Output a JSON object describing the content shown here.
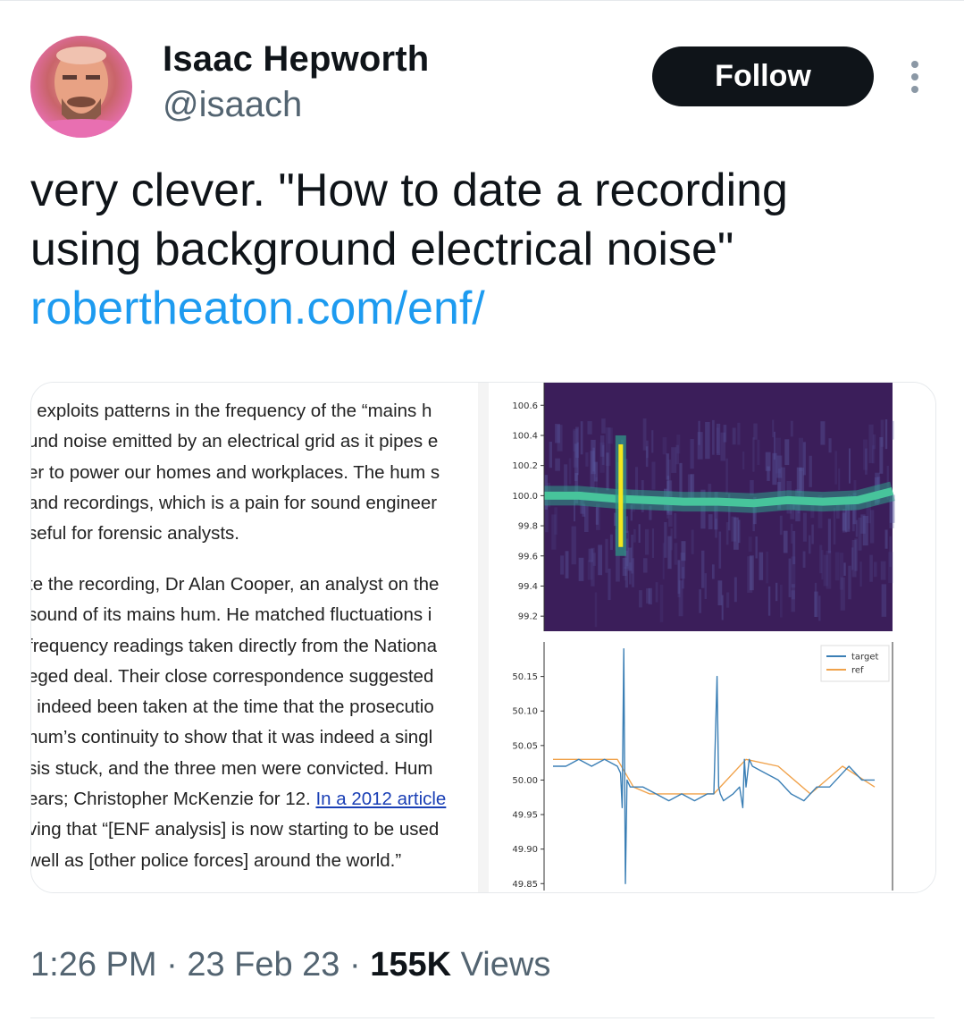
{
  "author": {
    "name": "Isaac Hepworth",
    "handle": "@isaach"
  },
  "follow_label": "Follow",
  "tweet": {
    "text_line1": "very clever. \"How to date a recording",
    "text_line2": "using background electrical noise\"",
    "link": "robertheaton.com/enf/"
  },
  "article": {
    "para1": [
      "j exploits patterns in the frequency of the “mains h",
      "und noise emitted by an electrical grid as it pipes e",
      "er to power our homes and workplaces. The hum s",
      "and recordings, which is a pain for sound engineer",
      "seful for forensic analysts."
    ],
    "para2": [
      "te the recording, Dr Alan Cooper, an analyst on the",
      " sound of its mains hum. He matched fluctuations i",
      "frequency readings taken directly from the Nationa",
      "eged deal. Their close correspondence suggested",
      "l indeed been taken at the time that the prosecutio",
      " hum’s continuity to show that it was indeed a singl",
      "sis stuck, and the three men were convicted. Hum",
      "ears; Christopher McKenzie for 12. "
    ],
    "link_text": "In a 2012 article",
    "para2_tail": [
      "ving that “[ENF analysis] is now starting to be used",
      "well as [other police forces] around the world.”"
    ]
  },
  "chart_data": [
    {
      "type": "heatmap",
      "yticks": [
        "100.6",
        "100.4",
        "100.2",
        "100.0",
        "99.8",
        "99.6",
        "99.4",
        "99.2"
      ],
      "ylim": [
        99.1,
        100.75
      ],
      "colormap": [
        "#3b1e5a",
        "#2f9c8a",
        "#f2e61e"
      ],
      "series": [
        {
          "x": [
            0,
            0.1,
            0.2,
            0.3,
            0.4,
            0.5,
            0.6,
            0.7,
            0.8,
            0.9,
            1.0
          ],
          "y": [
            100.0,
            100.0,
            99.98,
            99.97,
            99.96,
            99.96,
            99.95,
            99.97,
            99.96,
            99.97,
            100.03
          ]
        }
      ],
      "spike": {
        "x": 0.22,
        "from": 99.6,
        "to": 100.4
      }
    },
    {
      "type": "line",
      "yticks": [
        "50.15",
        "50.10",
        "50.05",
        "50.00",
        "49.95",
        "49.90",
        "49.85"
      ],
      "ylim": [
        49.84,
        50.2
      ],
      "legend_position": "top-right",
      "series": [
        {
          "name": "target",
          "color": "#3b7fb5",
          "x": [
            0,
            4,
            8,
            12,
            16,
            20,
            21,
            21.5,
            22,
            22.5,
            23,
            24,
            28,
            32,
            36,
            40,
            44,
            48,
            50,
            51,
            51.5,
            52,
            53,
            56,
            58,
            59,
            59.5,
            60,
            61,
            62,
            66,
            70,
            74,
            78,
            80,
            82,
            86,
            90,
            92,
            96,
            100
          ],
          "y": [
            50.02,
            50.02,
            50.03,
            50.02,
            50.03,
            50.02,
            50.01,
            49.96,
            50.19,
            49.85,
            50.0,
            49.99,
            49.99,
            49.98,
            49.97,
            49.98,
            49.97,
            49.98,
            49.98,
            50.15,
            49.99,
            49.98,
            49.97,
            49.98,
            49.99,
            49.96,
            50.03,
            49.99,
            50.03,
            50.02,
            50.01,
            50.0,
            49.98,
            49.97,
            49.98,
            49.99,
            49.99,
            50.01,
            50.02,
            50.0,
            50.0
          ]
        },
        {
          "name": "ref",
          "color": "#f0a24b",
          "x": [
            0,
            10,
            20,
            25,
            30,
            40,
            50,
            60,
            70,
            80,
            90,
            100
          ],
          "y": [
            50.03,
            50.03,
            50.03,
            49.99,
            49.98,
            49.98,
            49.98,
            50.03,
            50.02,
            49.98,
            50.02,
            49.99
          ]
        }
      ]
    }
  ],
  "timestamp": "1:26 PM",
  "date": "23 Feb 23",
  "views_count": "155K",
  "views_label": "Views",
  "colors": {
    "link": "#1d9bf0",
    "text": "#0f1419",
    "secondary": "#536471",
    "follow_bg": "#0f1419"
  }
}
